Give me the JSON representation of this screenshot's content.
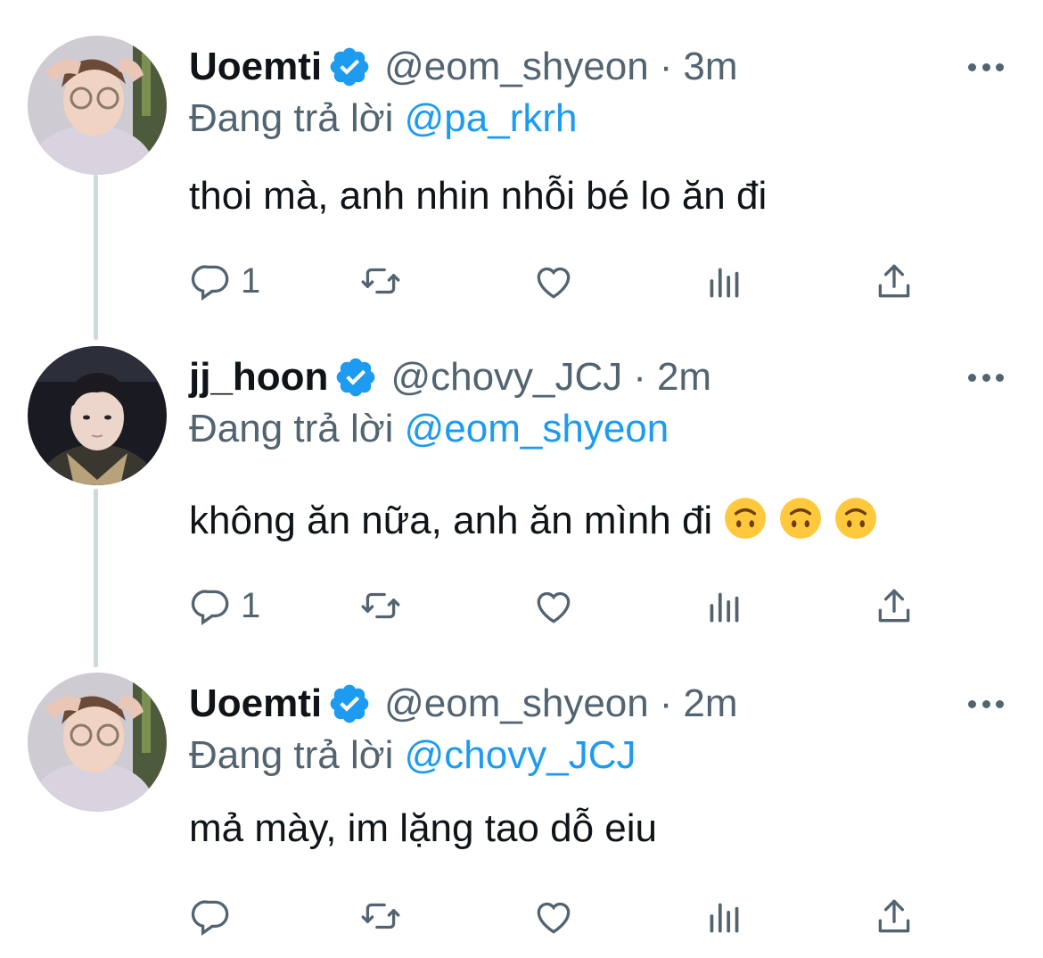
{
  "tweets": [
    {
      "name": "Uoemti",
      "handle": "@eom_shyeon",
      "separator": "·",
      "time": "3m",
      "replying_prefix": "Đang trả lời",
      "replying_to": "@pa_rkrh",
      "text": "thoi mà, anh nhin nhỗi bé lo ăn đi",
      "reply_count": "1",
      "avatar": "avatar-uoemti"
    },
    {
      "name": "jj_hoon",
      "handle": "@chovy_JCJ",
      "separator": "·",
      "time": "2m",
      "replying_prefix": "Đang trả lời",
      "replying_to": "@eom_shyeon",
      "text": "không ăn nữa, anh ăn mình đi",
      "emoji": [
        "upside-down-face-icon",
        "upside-down-face-icon",
        "upside-down-face-icon"
      ],
      "reply_count": "1",
      "avatar": "avatar-jj-hoon"
    },
    {
      "name": "Uoemti",
      "handle": "@eom_shyeon",
      "separator": "·",
      "time": "2m",
      "replying_prefix": "Đang trả lời",
      "replying_to": "@chovy_JCJ",
      "text": "mả mày, im lặng tao dỗ eiu",
      "reply_count": "",
      "avatar": "avatar-uoemti"
    }
  ],
  "colors": {
    "text": "#0f1419",
    "secondary": "#536471",
    "accent": "#1d9bf0",
    "thread_line": "#cfd9de"
  },
  "icons": [
    "reply-icon",
    "retweet-icon",
    "like-icon",
    "analytics-icon",
    "share-icon",
    "verified-badge-icon",
    "more-icon"
  ]
}
